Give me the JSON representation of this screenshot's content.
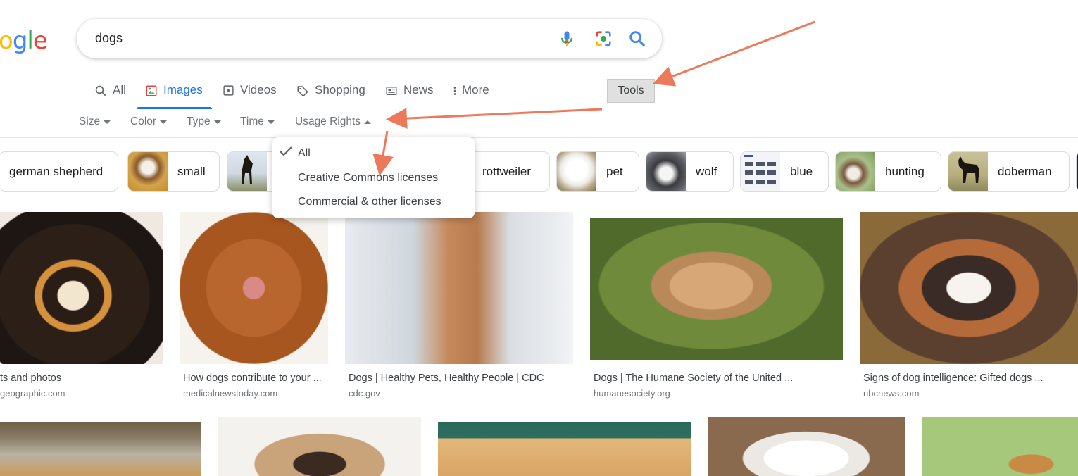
{
  "logo": {
    "text_visible": "ogle",
    "letters": [
      {
        "ch": "o",
        "color": "#fbbc05"
      },
      {
        "ch": "g",
        "color": "#4285f4"
      },
      {
        "ch": "l",
        "color": "#34a853"
      },
      {
        "ch": "e",
        "color": "#ea4335"
      }
    ]
  },
  "search": {
    "query": "dogs",
    "icons": [
      "mic-icon",
      "camera-lens-icon",
      "search-icon"
    ]
  },
  "tabs": [
    {
      "label": "All",
      "icon": "search-icon"
    },
    {
      "label": "Images",
      "icon": "image-icon",
      "active": true
    },
    {
      "label": "Videos",
      "icon": "play-icon"
    },
    {
      "label": "Shopping",
      "icon": "tag-icon"
    },
    {
      "label": "News",
      "icon": "newspaper-icon"
    },
    {
      "label": "More",
      "icon": "vertical-dots-icon"
    }
  ],
  "tools_label": "Tools",
  "filters": [
    {
      "label": "Size"
    },
    {
      "label": "Color"
    },
    {
      "label": "Type"
    },
    {
      "label": "Time"
    },
    {
      "label": "Usage Rights",
      "open": true
    }
  ],
  "chips": [
    {
      "label": "german shepherd"
    },
    {
      "label": "small"
    },
    {
      "label": ""
    },
    {
      "label": "rottweiler"
    },
    {
      "label": "pet"
    },
    {
      "label": "wolf"
    },
    {
      "label": "blue"
    },
    {
      "label": "hunting"
    },
    {
      "label": "doberman"
    }
  ],
  "usage_rights_menu": {
    "items": [
      {
        "label": "All",
        "checked": true
      },
      {
        "label": "Creative Commons licenses"
      },
      {
        "label": "Commercial & other licenses"
      }
    ]
  },
  "results": [
    {
      "caption": "ts and photos",
      "source": "geographic.com"
    },
    {
      "caption": "How dogs contribute to your ...",
      "source": "medicalnewstoday.com"
    },
    {
      "caption": "Dogs | Healthy Pets, Healthy People | CDC",
      "source": "cdc.gov"
    },
    {
      "caption": "Dogs | The Humane Society of the United ...",
      "source": "humanesociety.org"
    },
    {
      "caption": "Signs of dog intelligence: Gifted dogs ...",
      "source": "nbcnews.com"
    }
  ],
  "colors": {
    "accent": "#1a73e8",
    "annotation_arrow": "#ec7a5a"
  }
}
